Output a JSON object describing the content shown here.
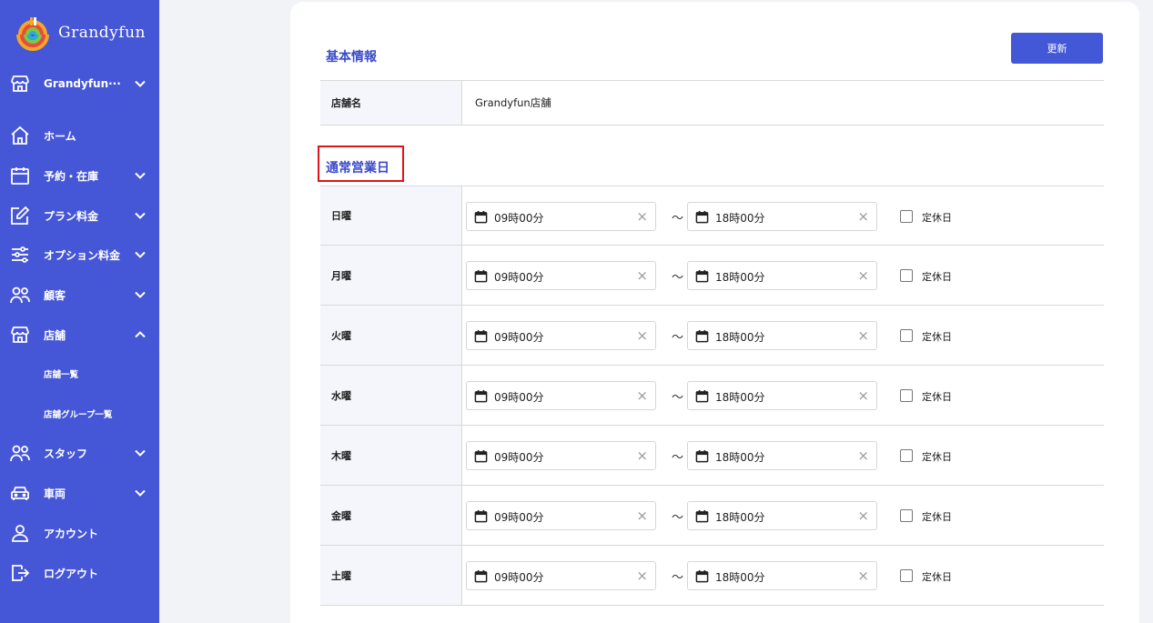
{
  "app": {
    "name": "Grandyfun"
  },
  "sidebar": {
    "store_selector": "Grandyfun···",
    "items": [
      {
        "label": "ホーム"
      },
      {
        "label": "予約・在庫"
      },
      {
        "label": "プラン料金"
      },
      {
        "label": "オプション料金"
      },
      {
        "label": "顧客"
      },
      {
        "label": "店舗"
      },
      {
        "label": "スタッフ"
      },
      {
        "label": "車両"
      },
      {
        "label": "アカウント"
      },
      {
        "label": "ログアウト"
      }
    ],
    "subitems": [
      {
        "label": "店舗一覧"
      },
      {
        "label": "店舗グループ一覧"
      }
    ]
  },
  "main": {
    "update_label": "更新",
    "basic_info": {
      "title": "基本情報",
      "store_name_label": "店舗名",
      "store_name_value": "Grandyfun店舗"
    },
    "business_days": {
      "title": "通常営業日",
      "separator": "～",
      "holiday_label": "定休日",
      "days": [
        {
          "day": "日曜",
          "open": "09時00分",
          "close": "18時00分",
          "holiday": false
        },
        {
          "day": "月曜",
          "open": "09時00分",
          "close": "18時00分",
          "holiday": false
        },
        {
          "day": "火曜",
          "open": "09時00分",
          "close": "18時00分",
          "holiday": false
        },
        {
          "day": "水曜",
          "open": "09時00分",
          "close": "18時00分",
          "holiday": false
        },
        {
          "day": "木曜",
          "open": "09時00分",
          "close": "18時00分",
          "holiday": false
        },
        {
          "day": "金曜",
          "open": "09時00分",
          "close": "18時00分",
          "holiday": false
        },
        {
          "day": "土曜",
          "open": "09時00分",
          "close": "18時00分",
          "holiday": false
        }
      ]
    }
  },
  "colors": {
    "sidebar_bg": "#4557d6",
    "accent": "#3b4bc8",
    "highlight_border": "#e0141b"
  }
}
